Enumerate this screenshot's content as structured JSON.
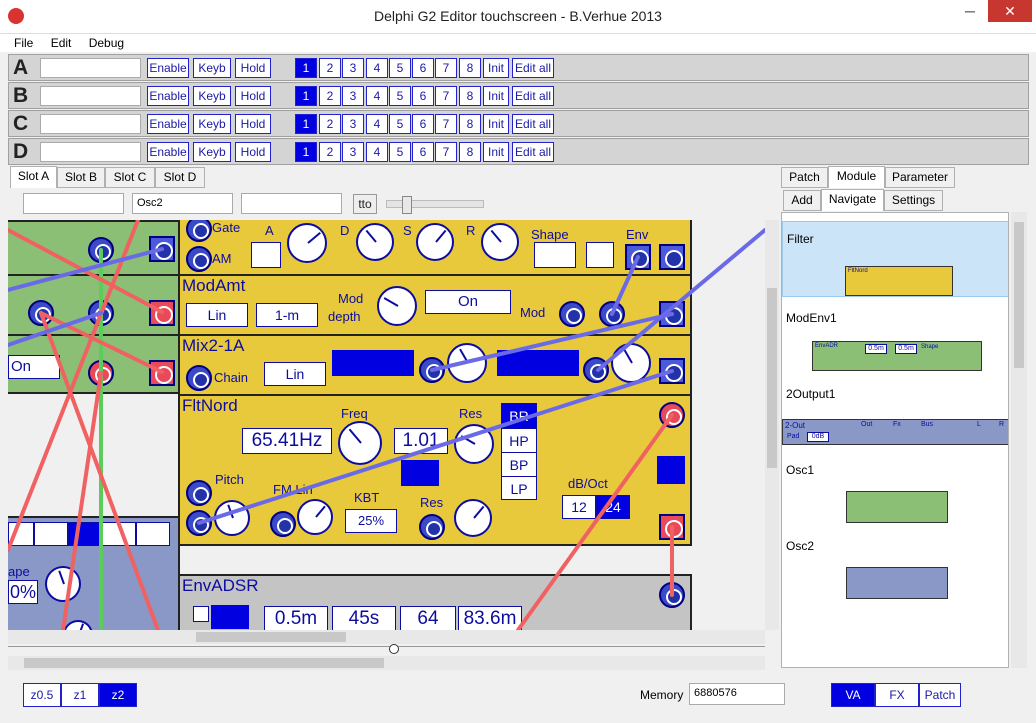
{
  "window": {
    "title": "Delphi G2 Editor touchscreen - B.Verhue 2013",
    "minimize": "─",
    "maximize": "☐",
    "close": "✕"
  },
  "menu": [
    "File",
    "Edit",
    "Debug"
  ],
  "slots": [
    {
      "letter": "A"
    },
    {
      "letter": "B"
    },
    {
      "letter": "C"
    },
    {
      "letter": "D"
    }
  ],
  "slot_buttons": {
    "enable": "Enable",
    "keyb": "Keyb",
    "hold": "Hold",
    "variations": [
      "1",
      "2",
      "3",
      "4",
      "5",
      "6",
      "7",
      "8"
    ],
    "init": "Init",
    "edit_all": "Edit all"
  },
  "slot_tabs": [
    "Slot A",
    "Slot B",
    "Slot C",
    "Slot D"
  ],
  "toolbar": {
    "field1": "",
    "module_name": "Osc2",
    "field3": "",
    "tto": "tto"
  },
  "right_tabs": [
    "Patch",
    "Module",
    "Parameter"
  ],
  "right_subtabs": [
    "Add",
    "Navigate",
    "Settings"
  ],
  "module_list": [
    "Filter",
    "ModEnv1",
    "2Output1",
    "Osc1",
    "Osc2"
  ],
  "modules": {
    "env_top": {
      "gate": "Gate",
      "am": "AM",
      "a": "A",
      "d": "D",
      "s": "S",
      "r": "R",
      "shape": "Shape",
      "env": "Env"
    },
    "modamt": {
      "title": "ModAmt",
      "lin": "Lin",
      "onem": "1-m",
      "mod_depth_1": "Mod",
      "mod_depth_2": "depth",
      "on": "On",
      "mod": "Mod"
    },
    "mix": {
      "title": "Mix2-1A",
      "chain": "Chain",
      "lin": "Lin"
    },
    "left_small": {
      "on": "On",
      "ape": "ape",
      "pct": "0%"
    },
    "fltnord": {
      "title": "FltNord",
      "freq": "Freq",
      "freq_val": "65.41Hz",
      "res": "Res",
      "res_val": "1.01",
      "modes": [
        "BR",
        "HP",
        "BP",
        "LP"
      ],
      "pitch": "Pitch",
      "fmlin": "FM Lin",
      "kbt": "KBT",
      "kbt_val": "25%",
      "res2": "Res",
      "dboct": "dB/Oct",
      "db12": "12",
      "db24": "24"
    },
    "envadsr": {
      "title": "EnvADSR",
      "vals": [
        "0.5m",
        "45s",
        "64",
        "83.6m"
      ]
    }
  },
  "zoom": [
    "z0.5",
    "z1",
    "z2"
  ],
  "memory": {
    "label": "Memory",
    "value": "6880576"
  },
  "bottom_right": [
    "VA",
    "FX",
    "Patch"
  ],
  "thumbs": {
    "filter": {
      "title": "FltNord"
    },
    "modenv": {
      "title": "EnvADR",
      "v1": "0.5m",
      "v2": "0.5m",
      "shape": "Shape"
    },
    "out2": {
      "title": "2-Out",
      "pad": "Pad",
      "db": "0dB",
      "out": "Out",
      "fx": "Fx",
      "bus": "Bus",
      "l": "L",
      "r": "R"
    }
  },
  "colors": {
    "accent": "#0000e0",
    "module_yellow": "#e8c93c",
    "module_green": "#8bbf76",
    "cable_red": "#f06262",
    "cable_blue": "#6a6ae8",
    "cable_green": "#5ccc5c"
  }
}
